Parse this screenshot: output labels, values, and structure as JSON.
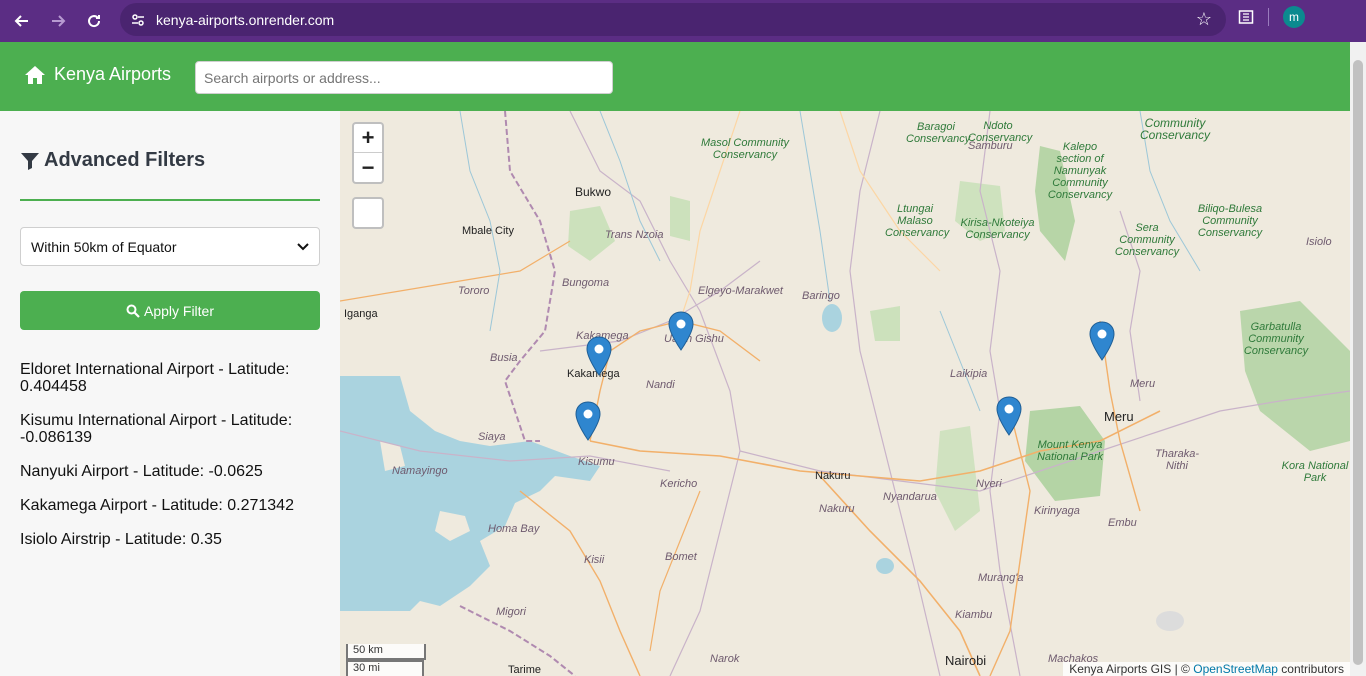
{
  "browser": {
    "url": "kenya-airports.onrender.com",
    "profile_initial": "m"
  },
  "header": {
    "brand": "Kenya Airports",
    "search_placeholder": "Search airports or address..."
  },
  "sidebar": {
    "title": "Advanced Filters",
    "filter_selected": "Within 50km of Equator",
    "apply_label": "Apply Filter",
    "results": [
      "Eldoret International Airport - Latitude: 0.404458",
      "Kisumu International Airport - Latitude: -0.086139",
      "Nanyuki Airport - Latitude: -0.0625",
      "Kakamega Airport - Latitude: 0.271342",
      "Isiolo Airstrip - Latitude: 0.35"
    ]
  },
  "map": {
    "zoom_in": "+",
    "zoom_out": "−",
    "scale_km": "50 km",
    "scale_mi": "30 mi",
    "attribution_prefix": "Kenya Airports GIS | ©",
    "attribution_link": "OpenStreetMap",
    "attribution_suffix": "contributors",
    "labels": {
      "bukwo": "Bukwo",
      "mbale": "Mbale City",
      "trans_nzoia": "Trans Nzoia",
      "tororo": "Tororo",
      "bungoma": "Bungoma",
      "iganga": "Iganga",
      "kakamega_county": "Kakamega",
      "kakamega_town": "Kakamega",
      "busia": "Busia",
      "siaya": "Siaya",
      "namayingo": "Namayingo",
      "kisumu": "Kisumu",
      "nandi": "Nandi",
      "uasin_gishu": "Uasin Gishu",
      "elgeyo": "Elgeyo-Marakwet",
      "baringo": "Baringo",
      "laikipia": "Laikipia",
      "kericho": "Kericho",
      "nakuru_town": "Nakuru",
      "nakuru_county": "Nakuru",
      "nyandarua": "Nyandarua",
      "nyeri": "Nyeri",
      "kirinyaga": "Kirinyaga",
      "embu": "Embu",
      "meru_county": "Meru",
      "meru_town": "Meru",
      "tharaka": "Tharaka-Nithi",
      "homa_bay": "Homa Bay",
      "kisii": "Kisii",
      "bomet": "Bomet",
      "migori": "Migori",
      "narok": "Narok",
      "muranga": "Murang'a",
      "kiambu": "Kiambu",
      "nairobi": "Nairobi",
      "machakos": "Machakos",
      "tarime": "Tarime",
      "samburu": "Samburu",
      "isiolo": "Isiolo",
      "masol": "Masol Community Conservancy",
      "baragoi": "Baragoi Conservancy",
      "ndoto": "Ndoto Conservancy",
      "kalepo": "Kalepo section of Namunyak Community Conservancy",
      "ltungai": "Ltungai Malaso Conservancy",
      "kirisa": "Kirisa-Nkoteiya Conservancy",
      "sera": "Sera Community Conservancy",
      "biliqo": "Biliqo-Bulesa Community Conservancy",
      "community_top": "Community Conservancy",
      "garbatulla": "Garbatulla Community Conservancy",
      "mount_kenya": "Mount Kenya National Park",
      "kora": "Kora National Park"
    }
  }
}
